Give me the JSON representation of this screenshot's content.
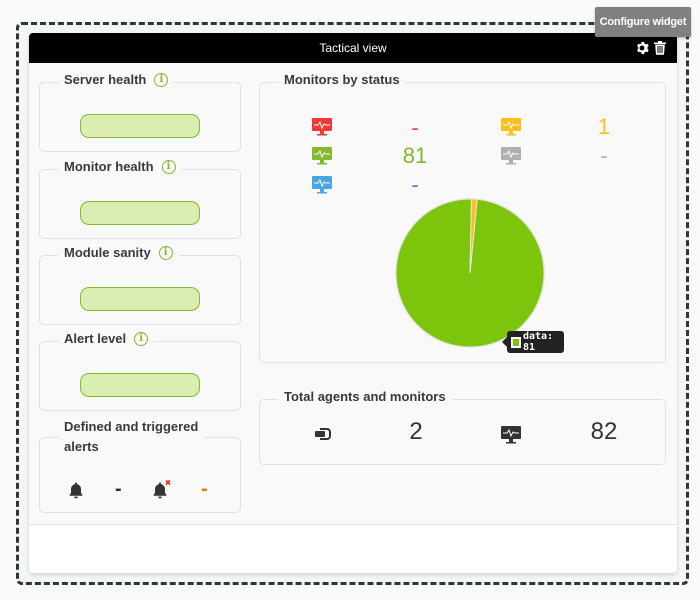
{
  "tooltip": "Configure widget",
  "widget": {
    "title": "Tactical view",
    "icons": [
      "gear-icon",
      "trash-icon"
    ]
  },
  "left_panels": [
    {
      "title": "Server health",
      "info": "i",
      "bar_color": "#dbeeb1"
    },
    {
      "title": "Monitor health",
      "info": "i",
      "bar_color": "#dbeeb1"
    },
    {
      "title": "Module sanity",
      "info": "i",
      "bar_color": "#dbeeb1"
    },
    {
      "title": "Alert level",
      "info": "i",
      "bar_color": "#dbeeb1"
    }
  ],
  "alerts_panel": {
    "title_line1": "Defined and triggered",
    "title_line2": "alerts",
    "defined_value": "-",
    "triggered_value": "-",
    "defined_color": "#333333",
    "triggered_color": "#f0700f"
  },
  "monitors_by_status": {
    "title": "Monitors by status",
    "items": [
      {
        "status": "critical",
        "icon": "monitor-critical-icon",
        "color": "#f13838",
        "value": "-"
      },
      {
        "status": "warning",
        "icon": "monitor-warning-icon",
        "color": "#fcbf1b",
        "value": "1"
      },
      {
        "status": "normal",
        "icon": "monitor-normal-icon",
        "color": "#82b92e",
        "value": "81"
      },
      {
        "status": "unknown",
        "icon": "monitor-unknown-icon",
        "color": "#b0b0b0",
        "value": "-"
      },
      {
        "status": "not-init",
        "icon": "monitor-notinit-icon",
        "color": "#4aa6e2",
        "value": "-"
      }
    ],
    "chart_tooltip": "data: 81"
  },
  "chart_data": {
    "type": "pie",
    "title": "Monitors by status",
    "slices": [
      {
        "label": "normal",
        "value": 81,
        "color": "#7dc40c"
      },
      {
        "label": "warning",
        "value": 1,
        "color": "#fcbf1b"
      }
    ],
    "tooltip": "data: 81"
  },
  "totals": {
    "title": "Total agents and monitors",
    "agents_icon": "agent-icon",
    "agents": "2",
    "monitors_icon": "monitor-icon",
    "monitors": "82"
  }
}
